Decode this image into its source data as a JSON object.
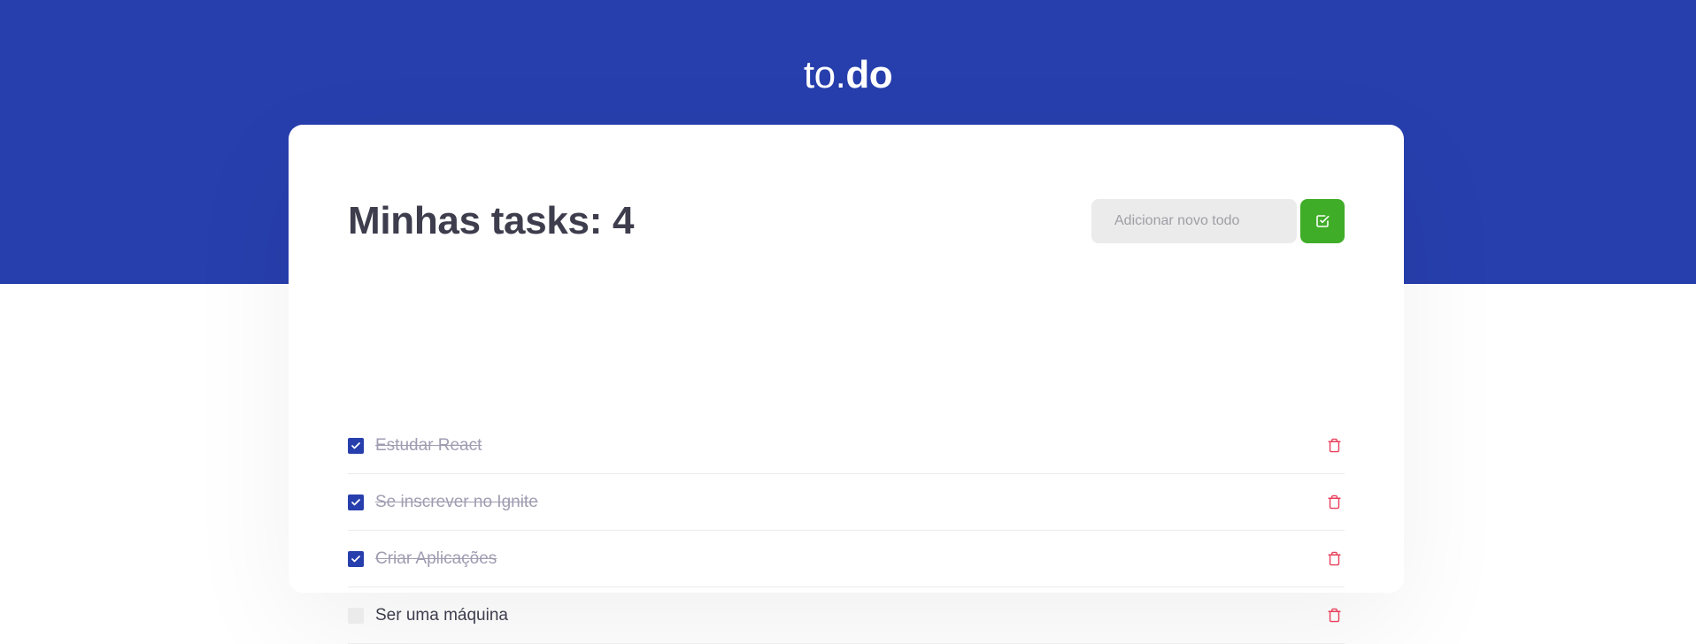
{
  "header": {
    "logo_light": "to.",
    "logo_bold": "do",
    "background_color": "#273FAD"
  },
  "main": {
    "title": "Minhas tasks: 4",
    "input_placeholder": "Adicionar novo todo",
    "input_value": "",
    "add_button_icon": "check-square-icon",
    "add_button_color": "#3FAD27"
  },
  "tasks": [
    {
      "title": "Estudar React",
      "done": true,
      "delete_icon": "trash-icon"
    },
    {
      "title": "Se inscrever no Ignite",
      "done": true,
      "delete_icon": "trash-icon"
    },
    {
      "title": "Criar Aplicações",
      "done": true,
      "delete_icon": "trash-icon"
    },
    {
      "title": "Ser uma máquina",
      "done": false,
      "delete_icon": "trash-icon"
    }
  ],
  "colors": {
    "checkbox_checked": "#273FAD",
    "trash": "#E83F5B",
    "done_text": "#A09CB1"
  }
}
